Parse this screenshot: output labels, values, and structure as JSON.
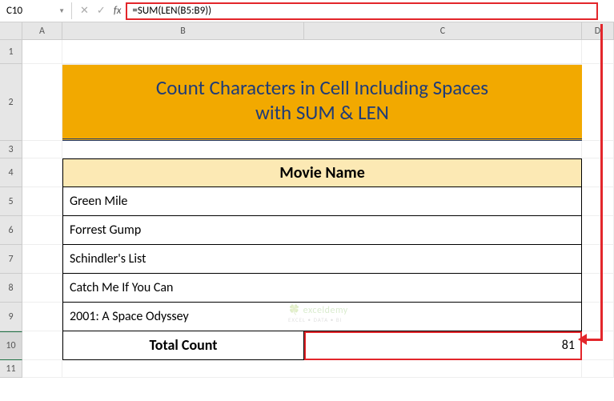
{
  "formula_bar": {
    "cell_ref": "C10",
    "formula": "=SUM(LEN(B5:B9))"
  },
  "columns": {
    "A": "A",
    "B": "B",
    "C": "C",
    "D": "D"
  },
  "rows": {
    "r1": "1",
    "r2": "2",
    "r3": "3",
    "r4": "4",
    "r5": "5",
    "r6": "6",
    "r7": "7",
    "r8": "8",
    "r9": "9",
    "r10": "10",
    "r11": "11"
  },
  "title": {
    "line1": "Count Characters in Cell Including Spaces",
    "line2": "with SUM & LEN"
  },
  "table": {
    "header": "Movie Name",
    "rows": [
      "Green Mile",
      "Forrest Gump",
      "Schindler's List",
      "Catch  Me If You Can",
      "2001: A Space Odyssey"
    ],
    "total_label": "Total Count",
    "total_value": "81"
  },
  "watermark": {
    "brand": "exceldemy",
    "tag": "EXCEL • DATA • BI"
  },
  "chart_data": {
    "type": "table",
    "title": "Count Characters in Cell Including Spaces with SUM & LEN",
    "columns": [
      "Movie Name"
    ],
    "rows": [
      [
        "Green Mile"
      ],
      [
        "Forrest Gump"
      ],
      [
        "Schindler's List"
      ],
      [
        "Catch  Me If You Can"
      ],
      [
        "2001: A Space Odyssey"
      ]
    ],
    "summary": {
      "label": "Total Count",
      "value": 81,
      "formula": "=SUM(LEN(B5:B9))"
    }
  }
}
